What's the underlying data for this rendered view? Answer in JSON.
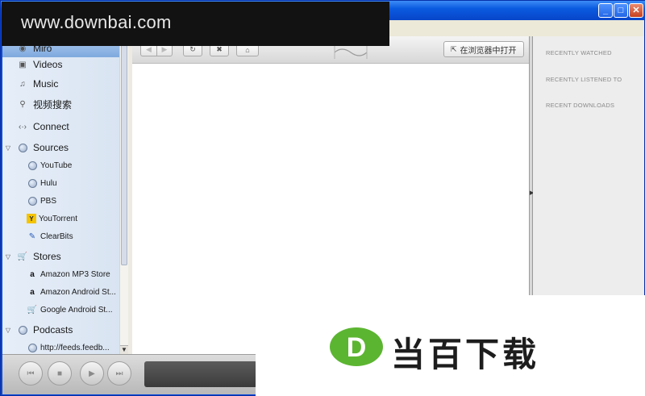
{
  "watermark": {
    "top_text": "www.downbai.com",
    "bottom_logo_letter": "D",
    "bottom_text": "当百下载"
  },
  "titlebar": {
    "minimize": "_",
    "maximize": "□",
    "close": "✕"
  },
  "sidebar": {
    "items": [
      {
        "label": "Miro",
        "icon": "miro-icon"
      },
      {
        "label": "Videos",
        "icon": "videos-icon"
      },
      {
        "label": "Music",
        "icon": "music-icon"
      },
      {
        "label": "视频搜索",
        "icon": "search-icon"
      },
      {
        "label": "Connect",
        "icon": "connect-icon"
      },
      {
        "label": "Sources",
        "icon": "globe-icon"
      },
      {
        "label": "YouTube",
        "icon": "globe-icon"
      },
      {
        "label": "Hulu",
        "icon": "globe-icon"
      },
      {
        "label": "PBS",
        "icon": "globe-icon"
      },
      {
        "label": "YouTorrent",
        "icon": "youtorrent-icon"
      },
      {
        "label": "ClearBits",
        "icon": "clearbits-icon"
      },
      {
        "label": "Stores",
        "icon": "cart-icon"
      },
      {
        "label": "Amazon MP3 Store",
        "icon": "amazon-icon"
      },
      {
        "label": "Amazon Android St...",
        "icon": "amazon-icon"
      },
      {
        "label": "Google Android St...",
        "icon": "cart-icon"
      },
      {
        "label": "Podcasts",
        "icon": "globe-icon"
      },
      {
        "label": "http://feeds.feedb...",
        "icon": "globe-icon"
      }
    ]
  },
  "browser": {
    "back": "◀",
    "forward": "▶",
    "reload": "↻",
    "stop": "✖",
    "home": "⌂",
    "open_in_browser": "在浏览器中打开"
  },
  "right_panel": {
    "recently_watched": "RECENTLY WATCHED",
    "recently_listened": "RECENTLY LISTENED TO",
    "recent_downloads": "RECENT DOWNLOADS"
  },
  "player": {
    "previous": "⏮",
    "stop": "■",
    "play": "▶",
    "next": "⏭"
  },
  "colors": {
    "xp_blue": "#0a49d8",
    "sidebar_bg": "#e6eef8",
    "logo_green": "#5cb531"
  }
}
